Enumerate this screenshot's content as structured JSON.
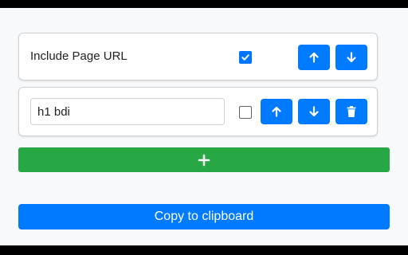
{
  "rows": [
    {
      "type": "static",
      "label": "Include Page URL",
      "checked": true,
      "icons": [
        "arrow-up-icon",
        "arrow-down-icon"
      ]
    },
    {
      "type": "input",
      "value": "h1 bdi",
      "checked": false,
      "icons": [
        "arrow-up-icon",
        "arrow-down-icon",
        "trash-icon"
      ]
    }
  ],
  "add_button": {
    "icon": "plus-icon"
  },
  "copy_button": {
    "label": "Copy to clipboard"
  },
  "colors": {
    "primary": "#007bff",
    "success": "#28a745",
    "checkbox_checked": "#0075ff",
    "background": "#f8f9fa"
  }
}
